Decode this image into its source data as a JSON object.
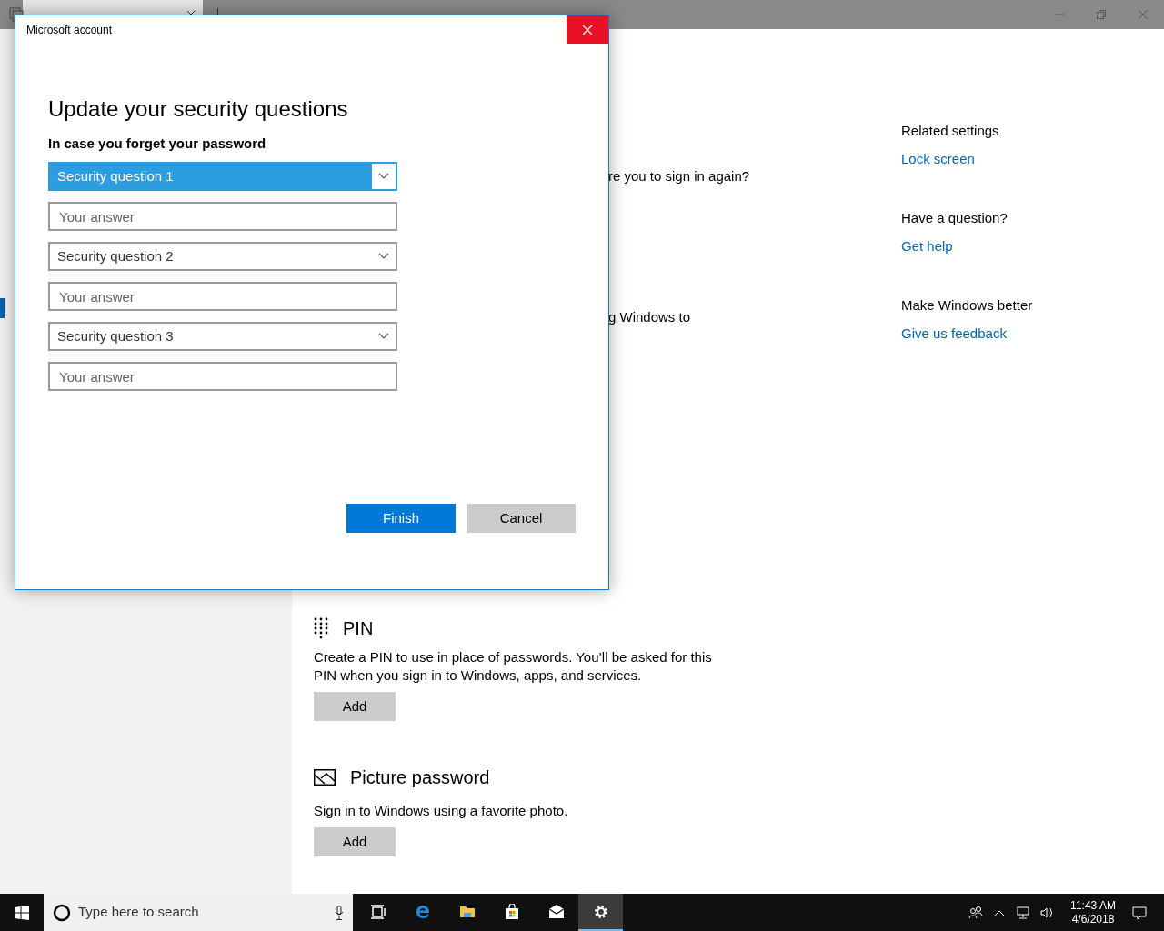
{
  "settings_window": {
    "partial_texts": [
      "re you to sign in again?",
      "g Windows to"
    ],
    "sections": [
      {
        "kind": "pin",
        "title": "PIN",
        "description": "Create a PIN to use in place of passwords. You’ll be asked for this PIN when you sign in to Windows, apps, and services.",
        "button": "Add"
      },
      {
        "kind": "picture",
        "title": "Picture password",
        "description": "Sign in to Windows using a favorite photo.",
        "button": "Add"
      }
    ],
    "related": [
      {
        "heading": "Related settings",
        "link": "Lock screen"
      },
      {
        "heading": "Have a question?",
        "link": "Get help"
      },
      {
        "heading": "Make Windows better",
        "link": "Give us feedback"
      }
    ]
  },
  "dialog": {
    "title": "Microsoft account",
    "heading": "Update your security questions",
    "subheading": "In case you forget your password",
    "rows": [
      {
        "kind": "select",
        "value": "Security question 1",
        "selected": true
      },
      {
        "kind": "answer",
        "placeholder": "Your answer"
      },
      {
        "kind": "select",
        "value": "Security question 2",
        "selected": false
      },
      {
        "kind": "answer",
        "placeholder": "Your answer"
      },
      {
        "kind": "select",
        "value": "Security question 3",
        "selected": false
      },
      {
        "kind": "answer",
        "placeholder": "Your answer"
      }
    ],
    "buttons": [
      {
        "label": "Finish",
        "kind": "primary"
      },
      {
        "label": "Cancel",
        "kind": "secondary"
      }
    ]
  },
  "taskbar": {
    "search_placeholder": "Type here to search",
    "apps": [
      {
        "kind": "taskview",
        "selected": false
      },
      {
        "kind": "edge",
        "selected": false
      },
      {
        "kind": "explorer",
        "selected": false
      },
      {
        "kind": "store",
        "selected": false
      },
      {
        "kind": "mail",
        "selected": false
      },
      {
        "kind": "settings",
        "selected": true
      }
    ],
    "time": "11:43 AM",
    "date": "4/6/2018"
  }
}
